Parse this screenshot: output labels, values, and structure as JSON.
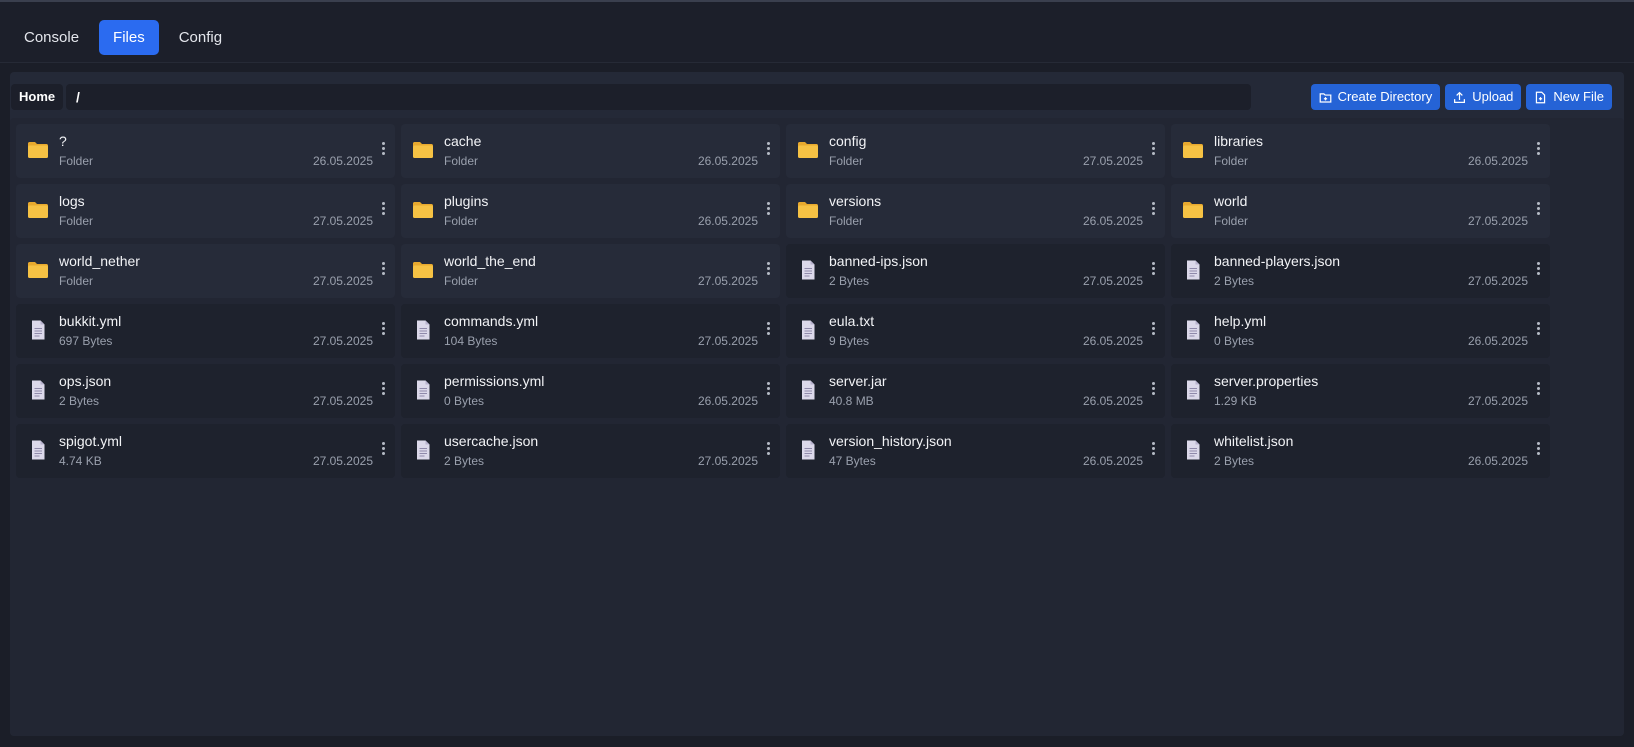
{
  "tabs": [
    "Console",
    "Files",
    "Config"
  ],
  "active_tab": "Files",
  "breadcrumb": {
    "home_label": "Home",
    "path": "/"
  },
  "actions": {
    "create_directory": "Create Directory",
    "upload": "Upload",
    "new_file": "New File"
  },
  "colors": {
    "accent": "#2b6bf0",
    "folder": "#f6c244",
    "file_icon": "#dcd9ea"
  },
  "items": [
    {
      "name": "?",
      "type": "folder",
      "info": "Folder",
      "date": "26.05.2025"
    },
    {
      "name": "cache",
      "type": "folder",
      "info": "Folder",
      "date": "26.05.2025"
    },
    {
      "name": "config",
      "type": "folder",
      "info": "Folder",
      "date": "27.05.2025"
    },
    {
      "name": "libraries",
      "type": "folder",
      "info": "Folder",
      "date": "26.05.2025"
    },
    {
      "name": "logs",
      "type": "folder",
      "info": "Folder",
      "date": "27.05.2025"
    },
    {
      "name": "plugins",
      "type": "folder",
      "info": "Folder",
      "date": "26.05.2025"
    },
    {
      "name": "versions",
      "type": "folder",
      "info": "Folder",
      "date": "26.05.2025"
    },
    {
      "name": "world",
      "type": "folder",
      "info": "Folder",
      "date": "27.05.2025"
    },
    {
      "name": "world_nether",
      "type": "folder",
      "info": "Folder",
      "date": "27.05.2025"
    },
    {
      "name": "world_the_end",
      "type": "folder",
      "info": "Folder",
      "date": "27.05.2025"
    },
    {
      "name": "banned-ips.json",
      "type": "file",
      "info": "2 Bytes",
      "date": "27.05.2025"
    },
    {
      "name": "banned-players.json",
      "type": "file",
      "info": "2 Bytes",
      "date": "27.05.2025"
    },
    {
      "name": "bukkit.yml",
      "type": "file",
      "info": "697 Bytes",
      "date": "27.05.2025"
    },
    {
      "name": "commands.yml",
      "type": "file",
      "info": "104 Bytes",
      "date": "27.05.2025"
    },
    {
      "name": "eula.txt",
      "type": "file",
      "info": "9 Bytes",
      "date": "26.05.2025"
    },
    {
      "name": "help.yml",
      "type": "file",
      "info": "0 Bytes",
      "date": "26.05.2025"
    },
    {
      "name": "ops.json",
      "type": "file",
      "info": "2 Bytes",
      "date": "27.05.2025"
    },
    {
      "name": "permissions.yml",
      "type": "file",
      "info": "0 Bytes",
      "date": "26.05.2025"
    },
    {
      "name": "server.jar",
      "type": "file",
      "info": "40.8 MB",
      "date": "26.05.2025"
    },
    {
      "name": "server.properties",
      "type": "file",
      "info": "1.29 KB",
      "date": "27.05.2025"
    },
    {
      "name": "spigot.yml",
      "type": "file",
      "info": "4.74 KB",
      "date": "27.05.2025"
    },
    {
      "name": "usercache.json",
      "type": "file",
      "info": "2 Bytes",
      "date": "27.05.2025"
    },
    {
      "name": "version_history.json",
      "type": "file",
      "info": "47 Bytes",
      "date": "26.05.2025"
    },
    {
      "name": "whitelist.json",
      "type": "file",
      "info": "2 Bytes",
      "date": "26.05.2025"
    }
  ]
}
